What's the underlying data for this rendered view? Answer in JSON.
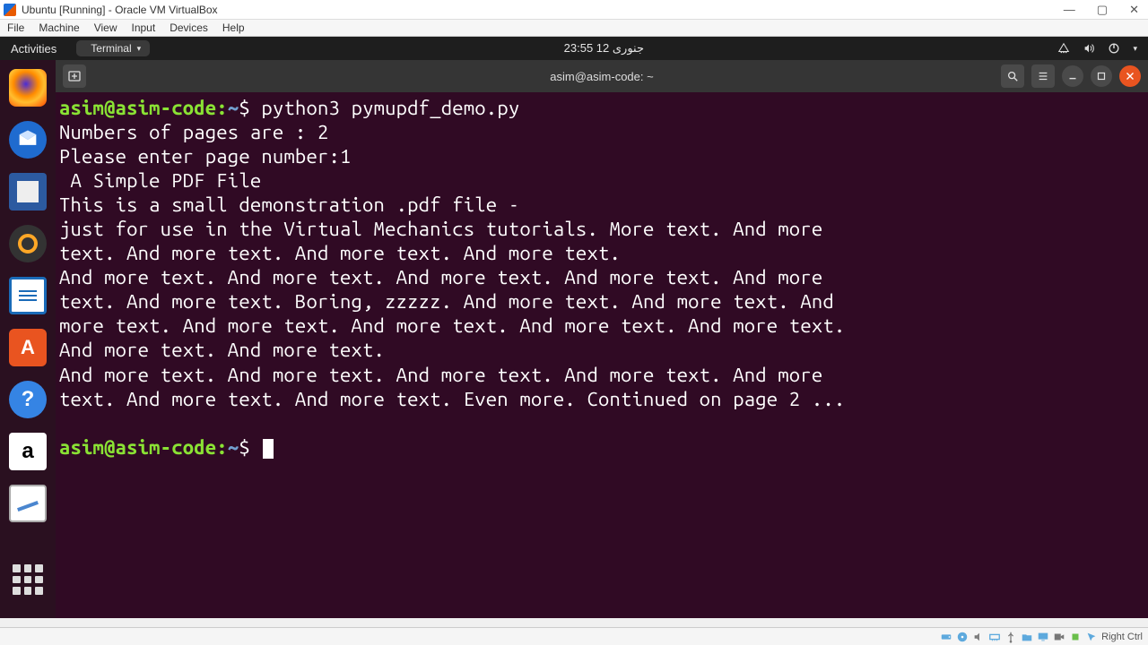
{
  "host": {
    "title": "Ubuntu [Running] - Oracle VM VirtualBox",
    "menus": [
      "File",
      "Machine",
      "View",
      "Input",
      "Devices",
      "Help"
    ],
    "right_ctrl": "Right Ctrl"
  },
  "gnome": {
    "activities": "Activities",
    "terminal_chip": "Terminal",
    "clock": "23:55 جنوری 12"
  },
  "dock": {
    "items": [
      {
        "name": "firefox-icon"
      },
      {
        "name": "thunderbird-icon"
      },
      {
        "name": "files-icon"
      },
      {
        "name": "rhythmbox-icon"
      },
      {
        "name": "writer-icon"
      },
      {
        "name": "software-icon"
      },
      {
        "name": "help-icon"
      },
      {
        "name": "amazon-icon"
      },
      {
        "name": "texteditor-icon"
      }
    ]
  },
  "terminal": {
    "title": "asim@asim-code: ~",
    "prompt_user": "asim@asim-code",
    "prompt_cwd": "~",
    "prompt_symbol": "$",
    "command": "python3 pymupdf_demo.py",
    "output": "Numbers of pages are : 2\nPlease enter page number:1\n A Simple PDF File \nThis is a small demonstration .pdf file - \njust for use in the Virtual Mechanics tutorials. More text. And more \ntext. And more text. And more text. And more text. \nAnd more text. And more text. And more text. And more text. And more \ntext. And more text. Boring, zzzzz. And more text. And more text. And \nmore text. And more text. And more text. And more text. And more text. \nAnd more text. And more text. \nAnd more text. And more text. And more text. And more text. And more \ntext. And more text. And more text. Even more. Continued on page 2 ...\n"
  }
}
